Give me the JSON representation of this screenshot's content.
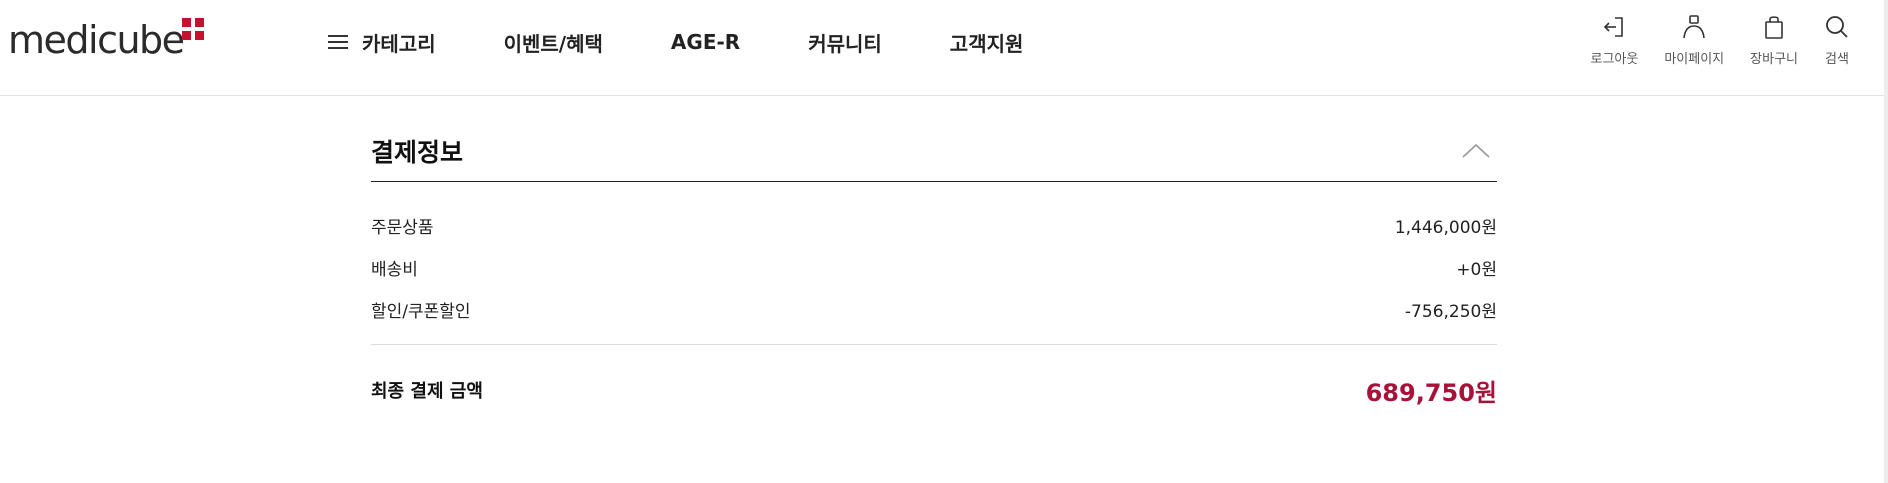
{
  "brand": {
    "logo_text": "medicube",
    "accent": "#c8102e"
  },
  "nav": {
    "items": [
      {
        "label": "카테고리",
        "icon": "hamburger-icon"
      },
      {
        "label": "이벤트/혜택"
      },
      {
        "label": "AGE-R"
      },
      {
        "label": "커뮤니티"
      },
      {
        "label": "고객지원"
      }
    ]
  },
  "utils": [
    {
      "label": "로그아웃",
      "icon": "logout-icon"
    },
    {
      "label": "마이페이지",
      "icon": "user-icon"
    },
    {
      "label": "장바구니",
      "icon": "shopping-bag-icon"
    },
    {
      "label": "검색",
      "icon": "search-icon"
    }
  ],
  "payment": {
    "title": "결제정보",
    "rows": [
      {
        "label": "주문상품",
        "value": "1,446,000원"
      },
      {
        "label": "배송비",
        "value": "+0원"
      },
      {
        "label": "할인/쿠폰할인",
        "value": "-756,250원"
      }
    ],
    "total_label": "최종 결제 금액",
    "total_value": "689,750원",
    "total_color": "#a8123a"
  }
}
